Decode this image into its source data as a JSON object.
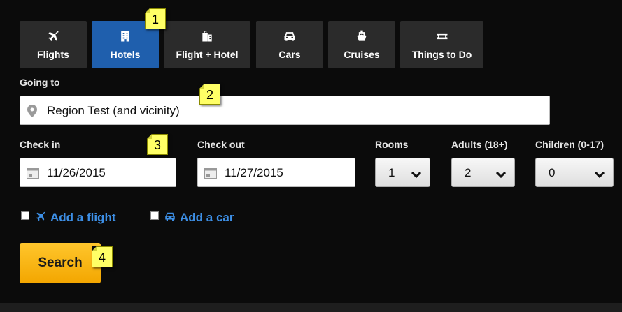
{
  "tabs": [
    {
      "label": "Flights",
      "icon": "airplane-icon"
    },
    {
      "label": "Hotels",
      "icon": "building-icon"
    },
    {
      "label": "Flight + Hotel",
      "icon": "luggage-icon"
    },
    {
      "label": "Cars",
      "icon": "car-icon"
    },
    {
      "label": "Cruises",
      "icon": "ship-icon"
    },
    {
      "label": "Things to Do",
      "icon": "ticket-icon"
    }
  ],
  "active_tab": "Hotels",
  "destination": {
    "label": "Going to",
    "value": "Region Test (and vicinity)",
    "icon": "map-pin-icon"
  },
  "check_in": {
    "label": "Check in",
    "value": "11/26/2015",
    "icon": "calendar-icon"
  },
  "check_out": {
    "label": "Check out",
    "value": "11/27/2015",
    "icon": "calendar-icon"
  },
  "rooms": {
    "label": "Rooms",
    "value": "1"
  },
  "adults": {
    "label": "Adults (18+)",
    "value": "2"
  },
  "children": {
    "label": "Children (0-17)",
    "value": "0"
  },
  "add_flight": {
    "label": "Add a flight",
    "checked": false,
    "icon": "airplane-icon"
  },
  "add_car": {
    "label": "Add a car",
    "checked": false,
    "icon": "car-icon"
  },
  "search_label": "Search",
  "callouts": [
    "1",
    "2",
    "3",
    "4"
  ],
  "colors": {
    "active_tab": "#1f5fad",
    "tab": "#2b2b2b",
    "link": "#3d8fe6",
    "search": "#f7b500",
    "callout": "#ffff66"
  }
}
